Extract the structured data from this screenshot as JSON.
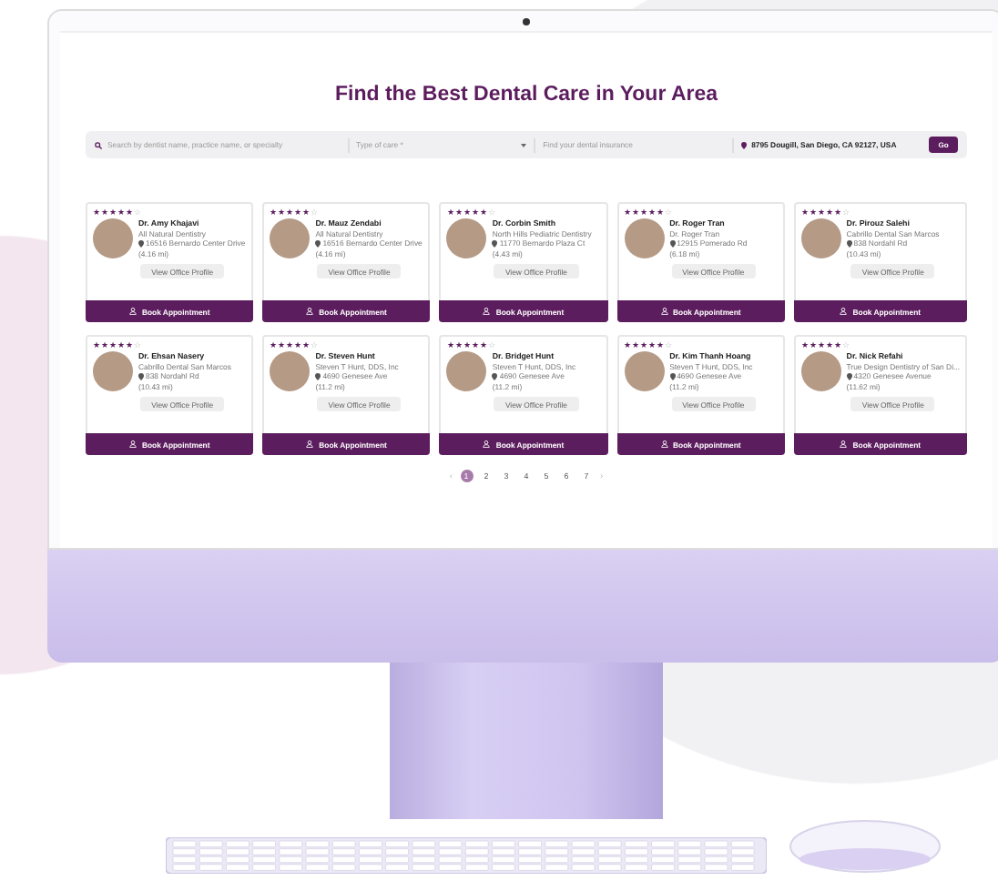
{
  "page": {
    "title": "Find the Best Dental Care in Your Area"
  },
  "search": {
    "query_placeholder": "Search by dentist name, practice name, or specialty",
    "care_placeholder": "Type of care *",
    "insurance_placeholder": "Find your dental insurance",
    "location": "8795 Dougill, San Diego, CA 92127, USA",
    "button": "Go"
  },
  "dentists": [
    {
      "name": "Dr. Amy Khajavi",
      "practice": "All Natural Dentistry",
      "address": "16516 Bernardo Center Drive",
      "distance": "(4.16 mi)",
      "stars": 5,
      "profile_button": "View Office Profile",
      "book_button": "Book Appointment"
    },
    {
      "name": "Dr. Mauz Zendabi",
      "practice": "All Natural Dentistry",
      "address": "16516 Bernardo Center Drive",
      "distance": "(4.16 mi)",
      "stars": 5,
      "profile_button": "View Office Profile",
      "book_button": "Book Appointment"
    },
    {
      "name": "Dr. Corbin Smith",
      "practice": "North Hills Pediatric Dentistry",
      "address": "11770 Bernardo Plaza Ct",
      "distance": "(4.43 mi)",
      "stars": 5,
      "profile_button": "View Office Profile",
      "book_button": "Book Appointment"
    },
    {
      "name": "Dr. Roger Tran",
      "practice": "Dr. Roger Tran",
      "address": "12915 Pomerado Rd",
      "distance": "(6.18 mi)",
      "stars": 5,
      "profile_button": "View Office Profile",
      "book_button": "Book Appointment"
    },
    {
      "name": "Dr. Pirouz Salehi",
      "practice": "Cabrillo Dental San Marcos",
      "address": "838 Nordahl Rd",
      "distance": "(10.43 mi)",
      "stars": 5,
      "profile_button": "View Office Profile",
      "book_button": "Book Appointment"
    },
    {
      "name": "Dr. Ehsan Nasery",
      "practice": "Cabrillo Dental San Marcos",
      "address": "838 Nordahl Rd",
      "distance": "(10.43 mi)",
      "stars": 5,
      "profile_button": "View Office Profile",
      "book_button": "Book Appointment"
    },
    {
      "name": "Dr. Steven Hunt",
      "practice": "Steven T Hunt, DDS, Inc",
      "address": "4690 Genesee Ave",
      "distance": "(11.2 mi)",
      "stars": 5,
      "profile_button": "View Office Profile",
      "book_button": "Book Appointment"
    },
    {
      "name": "Dr. Bridget Hunt",
      "practice": "Steven T Hunt, DDS, Inc",
      "address": "4690 Genesee Ave",
      "distance": "(11.2 mi)",
      "stars": 5,
      "profile_button": "View Office Profile",
      "book_button": "Book Appointment"
    },
    {
      "name": "Dr. Kim Thanh Hoang",
      "practice": "Steven T Hunt, DDS, Inc",
      "address": "4690 Genesee Ave",
      "distance": "(11.2 mi)",
      "stars": 5,
      "profile_button": "View Office Profile",
      "book_button": "Book Appointment"
    },
    {
      "name": "Dr. Nick Refahi",
      "practice": "True Design Dentistry of San Di...",
      "address": "4320 Genesee Avenue",
      "distance": "(11.62 mi)",
      "stars": 5,
      "profile_button": "View Office Profile",
      "book_button": "Book Appointment"
    }
  ],
  "pagination": {
    "prev": "‹",
    "pages": [
      {
        "label": "1",
        "selected": true
      },
      {
        "label": "2",
        "selected": false
      },
      {
        "label": "3",
        "selected": false
      },
      {
        "label": "4",
        "selected": false
      },
      {
        "label": "5",
        "selected": false
      },
      {
        "label": "6",
        "selected": false
      },
      {
        "label": "7",
        "selected": false
      }
    ],
    "next": "›"
  }
}
